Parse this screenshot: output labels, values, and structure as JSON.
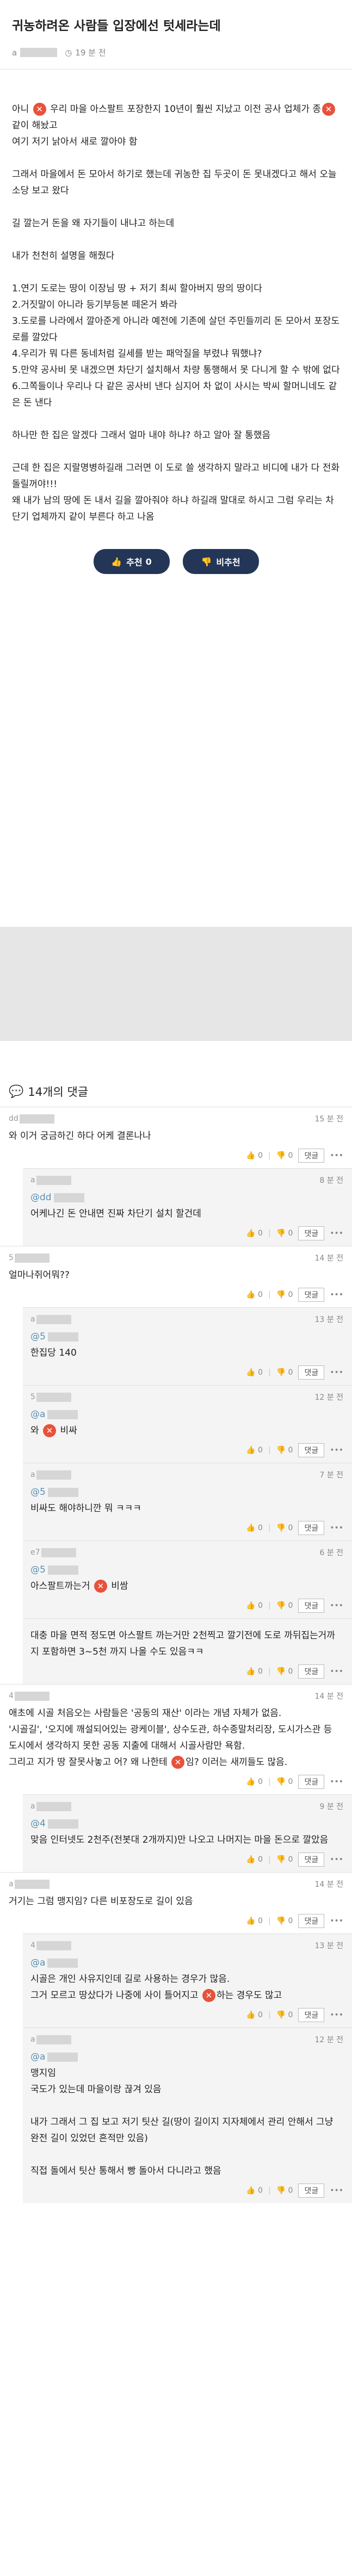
{
  "post": {
    "title": "귀농하려온 사람들 입장에선 텃세라는데",
    "author_initial": "a",
    "time": "19 분 전",
    "clock_icon": "clock-icon",
    "paragraphs": [
      [
        "아니 ",
        "X",
        " 우리 마을 아스팔트 포장한지 10년이 훨씬 지났고 이전 공사 업체가 종",
        "X",
        "같이 해놨고"
      ],
      [
        "여기 저기 낡아서 새로 깔아야 함"
      ],
      [],
      [
        "그래서 마을에서 돈 모아서 하기로 했는데 귀농한 집 두곳이 돈 못내겠다고 해서 오늘 소당 보고 왔다"
      ],
      [],
      [
        "길 깔는거 돈을 왜 자기들이 내냐고 하는데"
      ],
      [],
      [
        "내가 천천히 설명을 해줬다"
      ],
      [],
      [
        "1.연기 도로는 땅이 이장님 땅 + 저기 최씨 할아버지 땅의 땅이다"
      ],
      [
        "2.거짓말이 아니라 등기부등본 떼온거 봐라"
      ],
      [
        "3.도로를 나라에서 깔아준게 아니라 예전에 기존에 살던 주민들끼리 돈 모아서 포장도로를 깔았다"
      ],
      [
        "4.우리가 뭐 다른 동네처럼 길세를 받는 패악질을 부렸냐 뭐했냐?"
      ],
      [
        "5.만약 공사비 못 내겠으면 차단기 설치해서 차량 통행해서 못 다니게 할 수 밖에 없다"
      ],
      [
        "6.그쪽들이나 우리나 다 같은 공사비 낸다 심지어 차 없이 사시는 박씨 할머니네도 같은 돈 낸다"
      ],
      [],
      [
        "하나만 한 집은 알겠다 그래서 얼마 내야 하냐? 하고 알아 잘 통했음"
      ],
      [],
      [
        "근데 한 집은 지랄명병하길래 그러면 이 도로 쓸 생각하지 말라고 비디에 내가 다 전화 돌릴꺼야!!!"
      ],
      [
        "왜 내가 남의 땅에 돈 내서 길을 깔아줘야 하냐 하길래 말대로 하시고 그럼 우리는 차단기 업체까지 같이 부른다 하고 나옴"
      ]
    ],
    "upvote_label": "추천",
    "upvote_count": "0",
    "downvote_label": "비추천",
    "upvote_icon": "thumbs-up-icon",
    "downvote_icon": "thumbs-down-icon"
  },
  "comments_section": {
    "heading": "14개의 댓글",
    "heading_icon": "speech-bubbles-icon",
    "action_labels": {
      "up": "0",
      "down": "0",
      "reply": "댓글",
      "more": "•••"
    },
    "items": [
      {
        "level": 0,
        "author": "dd",
        "time": "15 분 전",
        "parts": [
          "와 이거 궁금하긴 하다 어케 결론나나"
        ]
      },
      {
        "level": 1,
        "author": "a",
        "time": "8 분 전",
        "tag": "@dd",
        "parts": [
          "어케나긴 돈 안내면 진짜 차단기 설치 할건데"
        ]
      },
      {
        "level": 0,
        "author": "5",
        "time": "14 분 전",
        "parts": [
          "얼마나쥐어뭐??"
        ]
      },
      {
        "level": 1,
        "author": "a",
        "time": "13 분 전",
        "tag": "@5",
        "parts": [
          "한집당 140"
        ]
      },
      {
        "level": 1,
        "author": "5",
        "time": "12 분 전",
        "tag": "@a",
        "parts": [
          "와 ",
          "X",
          " 비싸"
        ]
      },
      {
        "level": 1,
        "author": "a",
        "time": "7 분 전",
        "tag": "@5",
        "parts": [
          "비싸도 해야하니깐 뭐 ㅋㅋㅋ"
        ]
      },
      {
        "level": 1,
        "author": "e7",
        "time": "6 분 전",
        "tag": "@5",
        "parts": [
          "아스팔트까는거 ",
          "X",
          " 비쌈"
        ]
      },
      {
        "level": 1,
        "author": "",
        "time": "",
        "parts": [
          "대충 마을 면적 정도면 아스팔트 까는거만 2천찍고 깔기전에 도로 까뒤집는거까지 포함하면 3~5천 까지 나올 수도 있음ㅋㅋ"
        ]
      },
      {
        "level": 0,
        "author": "4",
        "time": "14 분 전",
        "parts": [
          "애초에 시골 처음오는 사람들은 '공동의 재산' 이라는 개념 자체가 없음.",
          "'시골길', '오지에 깨설되어있는 광케이블', 상수도관, 하수종말처리장, 도시가스관 등",
          "도시에서 생각하지 못한 공동 지출에 대해서 시골사람만 욕함.",
          "그리고 지가 땅 잘못사놓고 어? 왜 나한테 ",
          "X",
          "임? 이러는 새끼들도 많음."
        ]
      },
      {
        "level": 1,
        "author": "a",
        "time": "9 분 전",
        "tag": "@4",
        "parts": [
          "맞음 인터넷도 2천주(전봇대 2개까지)만 나오고 나머지는 마을 돈으로 깔았음"
        ]
      },
      {
        "level": 0,
        "author": "a",
        "time": "14 분 전",
        "parts": [
          "거기는 그럼 맹지임? 다른 비포장도로 길이 있음"
        ]
      },
      {
        "level": 1,
        "author": "4",
        "time": "13 분 전",
        "tag": "@a",
        "parts": [
          "시골은 개인 사유지인데 길로 사용하는 경우가 많음.",
          "그거 모르고 땅샀다가 나중에 사이 틀어지고 ",
          "X",
          "하는 경우도 많고"
        ]
      },
      {
        "level": 1,
        "author": "a",
        "time": "12 분 전",
        "tag": "@a",
        "parts": [
          "맹지임",
          "국도가 있는데 마을이랑 끊겨 있음",
          "",
          "내가 그래서 그 집 보고 저기 팃산 길(땅이 길이지 지자체에서 관리 안해서 그냥 완전 길이 있었던 흔적만 있음)",
          "",
          "직접 돌에서 팃산 통해서 빵 돌아서 다니라고 했음"
        ]
      }
    ]
  }
}
